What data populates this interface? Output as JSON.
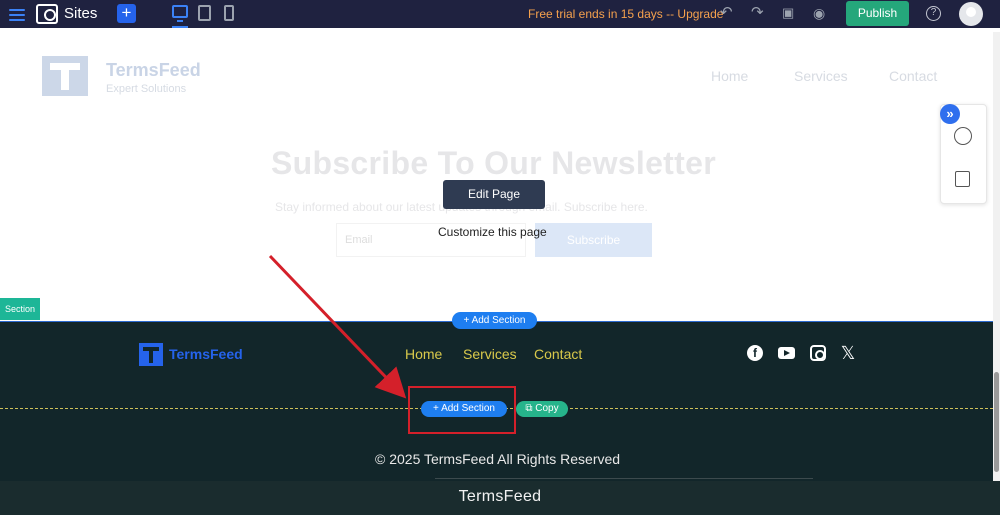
{
  "topbar": {
    "sites_label": "Sites",
    "trial_text": "Free trial ends in 15 days -- Upgrade",
    "publish_label": "Publish",
    "help_label": "?",
    "add_label": "+"
  },
  "page_header": {
    "brand_name": "TermsFeed",
    "brand_tagline": "Expert Solutions",
    "nav": [
      "Home",
      "Services",
      "Contact"
    ]
  },
  "newsletter": {
    "title": "Subscribe To Our Newsletter",
    "subtitle": "Stay informed about our latest updates through email. Subscribe here.",
    "email_placeholder": "Email",
    "subscribe_label": "Subscribe"
  },
  "overlay": {
    "edit_page_label": "Edit Page",
    "customize_label": "Customize this page",
    "section_tag": "Section",
    "add_section_top": "+ Add Section",
    "add_section_mid": "+ Add Section",
    "copy_label": "⧉ Copy"
  },
  "footer": {
    "brand_name": "TermsFeed",
    "nav": [
      "Home",
      "Services",
      "Contact"
    ],
    "social_icons": [
      "facebook-icon",
      "youtube-icon",
      "instagram-icon",
      "x-icon"
    ],
    "copyright": "© 2025 TermsFeed All Rights Reserved",
    "link_color": "#d9c94b",
    "background": "#12262a"
  },
  "caption": "TermsFeed",
  "colors": {
    "publish": "#25a77b",
    "accent_blue": "#1e7ef0",
    "highlight_red": "#d4202a",
    "section_teal": "#1db697"
  }
}
